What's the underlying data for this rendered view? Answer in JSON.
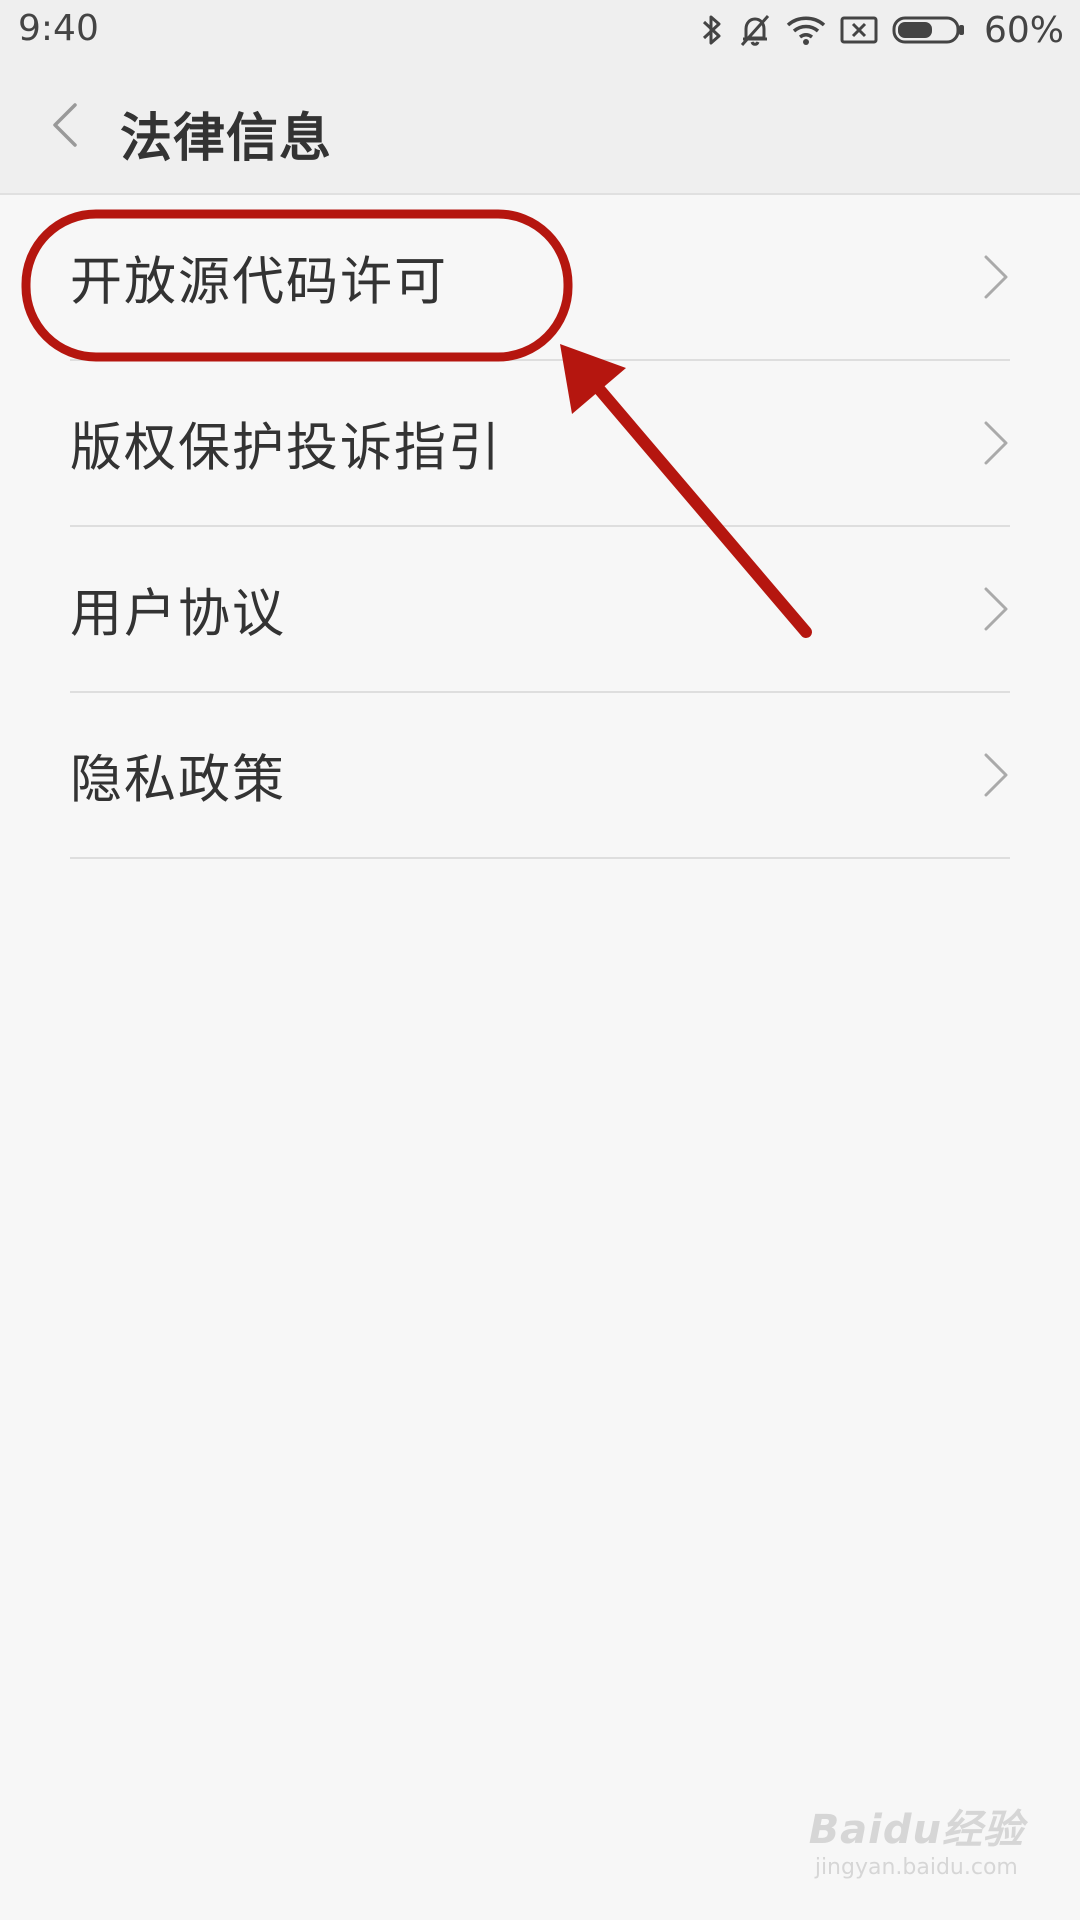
{
  "status_bar": {
    "time": "9:40",
    "battery_percent": "60%",
    "battery_level": 0.6,
    "icons": [
      "bluetooth-icon",
      "bell-off-icon",
      "wifi-icon",
      "sim-off-icon",
      "battery-icon"
    ]
  },
  "header": {
    "title": "法律信息",
    "back_icon": "chevron-left-icon"
  },
  "list": {
    "items": [
      {
        "label": "开放源代码许可",
        "icon": "chevron-right-icon"
      },
      {
        "label": "版权保护投诉指引",
        "icon": "chevron-right-icon"
      },
      {
        "label": "用户协议",
        "icon": "chevron-right-icon"
      },
      {
        "label": "隐私政策",
        "icon": "chevron-right-icon"
      }
    ]
  },
  "annotation": {
    "color": "#b5160f"
  },
  "watermark": {
    "logo": "Baidu经验",
    "url": "jingyan.baidu.com"
  },
  "colors": {
    "background": "#f7f7f7",
    "header": "#efefef",
    "text": "#333333",
    "divider": "#dedede"
  }
}
